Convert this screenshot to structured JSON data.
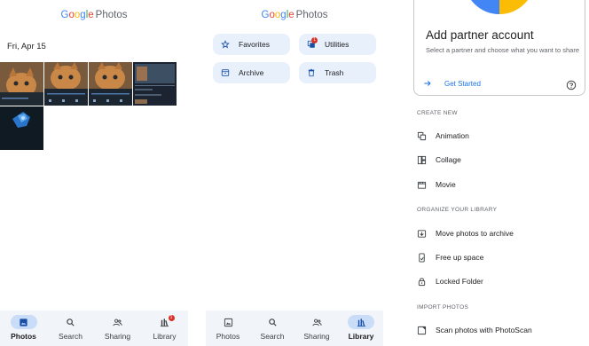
{
  "app": {
    "logo_google": [
      "G",
      "o",
      "o",
      "g",
      "l",
      "e"
    ],
    "logo_suffix": "Photos"
  },
  "photos_screen": {
    "date_label": "Fri, Apr 15",
    "thumbnails": [
      {
        "kind": "cat"
      },
      {
        "kind": "cat"
      },
      {
        "kind": "cat"
      },
      {
        "kind": "screenshot"
      },
      {
        "kind": "dark-blue"
      },
      {
        "kind": "blank"
      },
      {
        "kind": "blank"
      },
      {
        "kind": "blank"
      }
    ],
    "nav": [
      {
        "label": "Photos",
        "icon": "photo-icon",
        "active": true
      },
      {
        "label": "Search",
        "icon": "search-icon",
        "active": false
      },
      {
        "label": "Sharing",
        "icon": "people-icon",
        "active": false
      },
      {
        "label": "Library",
        "icon": "library-icon",
        "active": false,
        "badge": "1"
      }
    ]
  },
  "library_screen": {
    "chips": [
      {
        "label": "Favorites",
        "icon": "star-icon"
      },
      {
        "label": "Utilities",
        "icon": "utilities-icon",
        "badge": "1"
      },
      {
        "label": "Archive",
        "icon": "archive-icon"
      },
      {
        "label": "Trash",
        "icon": "trash-icon"
      }
    ],
    "nav": [
      {
        "label": "Photos",
        "icon": "photo-icon",
        "active": false
      },
      {
        "label": "Search",
        "icon": "search-icon",
        "active": false
      },
      {
        "label": "Sharing",
        "icon": "people-icon",
        "active": false
      },
      {
        "label": "Library",
        "icon": "library-icon",
        "active": true
      }
    ]
  },
  "utilities_screen": {
    "partner_card": {
      "title": "Add partner account",
      "description": "Select a partner and choose what you want to share",
      "action": "Get Started"
    },
    "sections": {
      "create_new": "CREATE NEW",
      "organize": "ORGANIZE YOUR LIBRARY",
      "import": "IMPORT PHOTOS"
    },
    "create_items": [
      {
        "label": "Animation",
        "icon": "animation-icon"
      },
      {
        "label": "Collage",
        "icon": "collage-icon"
      },
      {
        "label": "Movie",
        "icon": "movie-icon"
      }
    ],
    "organize_items": [
      {
        "label": "Move photos to archive",
        "icon": "archive-icon"
      },
      {
        "label": "Free up space",
        "icon": "phone-icon"
      },
      {
        "label": "Locked Folder",
        "icon": "lock-icon"
      }
    ],
    "import_items": [
      {
        "label": "Scan photos with PhotoScan",
        "icon": "photoscan-icon"
      }
    ]
  },
  "colors": {
    "accent": "#1a73e8",
    "chip_bg": "#e8f0fb",
    "nav_bg": "#f1f4f9",
    "nav_active_pill": "#c9dcf8",
    "badge": "#d93025"
  }
}
